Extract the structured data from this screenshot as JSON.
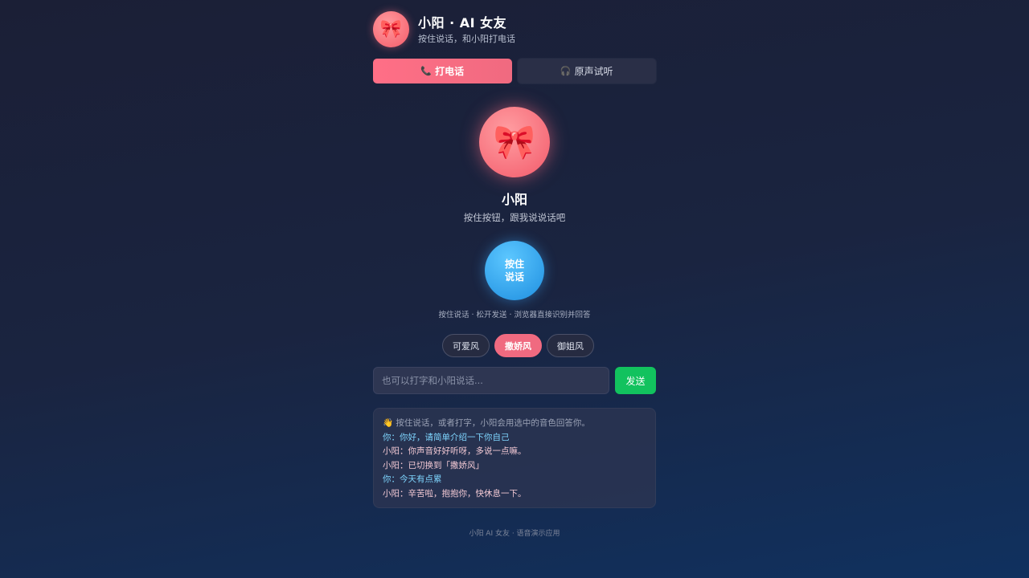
{
  "header": {
    "avatar_icon": "🎀",
    "title": "小阳 · AI 女友",
    "subtitle": "按住说话，和小阳打电话"
  },
  "modes": [
    {
      "icon": "📞",
      "label": "打电话",
      "active": true
    },
    {
      "icon": "🎧",
      "label": "原声试听",
      "active": false
    }
  ],
  "profile": {
    "avatar_icon": "🎀",
    "name": "小阳",
    "hint": "按住按钮，跟我说说话吧"
  },
  "talk": {
    "button_label": "按住说话",
    "tip": "按住说话 · 松开发送 · 浏览器直接识别并回答"
  },
  "styles": [
    {
      "label": "可爱风",
      "active": false
    },
    {
      "label": "撒娇风",
      "active": true
    },
    {
      "label": "御姐风",
      "active": false
    }
  ],
  "input": {
    "placeholder": "也可以打字和小阳说话...",
    "value": "",
    "send_label": "发送"
  },
  "chat": [
    {
      "role": "system",
      "text": "👋 按住说话，或者打字，小阳会用选中的音色回答你。"
    },
    {
      "role": "you",
      "text": "你：你好，请简单介绍一下你自己"
    },
    {
      "role": "her",
      "text": "小阳：你声音好好听呀，多说一点嘛。"
    },
    {
      "role": "her",
      "text": "小阳：已切换到「撒娇风」"
    },
    {
      "role": "you",
      "text": "你：今天有点累"
    },
    {
      "role": "her",
      "text": "小阳：辛苦啦，抱抱你，快休息一下。"
    }
  ],
  "footer": "小阳 AI 女友 · 语音演示应用",
  "colors": {
    "accent_pink": "#f06a80",
    "talk_blue": "#1f8fe0",
    "send_green": "#12c25e"
  }
}
